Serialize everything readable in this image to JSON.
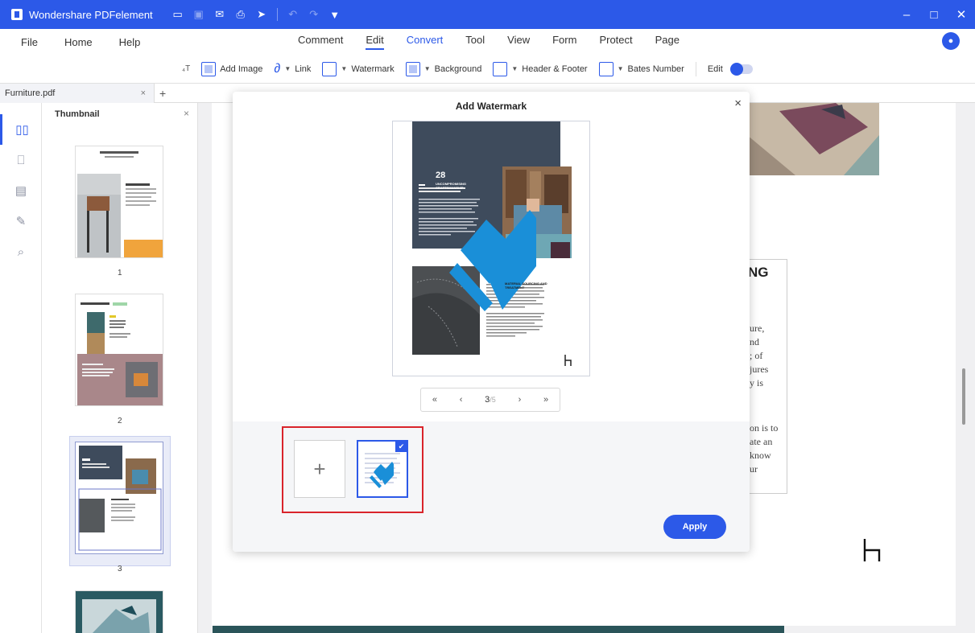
{
  "titlebar": {
    "app_title": "Wondershare PDFelement",
    "controls": {
      "minimize": "–",
      "maximize": "□",
      "close": "✕"
    }
  },
  "menu": {
    "left": [
      "File",
      "Home",
      "Help"
    ],
    "center": [
      "Comment",
      "Edit",
      "Convert",
      "Tool",
      "View",
      "Form",
      "Protect",
      "Page"
    ],
    "active": "Edit"
  },
  "toolbar": {
    "add_image": "Add Image",
    "link": "Link",
    "watermark": "Watermark",
    "background": "Background",
    "header_footer": "Header & Footer",
    "bates_number": "Bates Number",
    "edit": "Edit"
  },
  "tabs": {
    "file_name": "Furniture.pdf",
    "close": "×",
    "add": "+"
  },
  "thumbnail_panel": {
    "title": "Thumbnail",
    "close": "×",
    "pages": [
      "1",
      "2",
      "3"
    ],
    "selected_page": "3"
  },
  "modal": {
    "title": "Add Watermark",
    "close": "×",
    "preview": {
      "page_number": "28",
      "heading": "UNCOMPROMISING CRAFTSMANSHIP",
      "section_heading": "MATERIAL SOURCING AND TREATMENT"
    },
    "pager": {
      "first": "«",
      "prev": "‹",
      "current": "3",
      "total": "/5",
      "next": "›",
      "last": "»"
    },
    "add_template": "+",
    "apply_label": "Apply"
  },
  "document": {
    "heading_fragment": "NG",
    "lines_a": [
      "ure,",
      "nd",
      "; of",
      "jures",
      "y is"
    ],
    "lines_b": [
      "on is to",
      "ate an",
      "know",
      "ur"
    ]
  },
  "colors": {
    "brand_blue": "#2c59e8",
    "watermark_blue": "#1a8fd8",
    "highlight_red": "#d9242b",
    "slate": "#3e4b5c"
  }
}
